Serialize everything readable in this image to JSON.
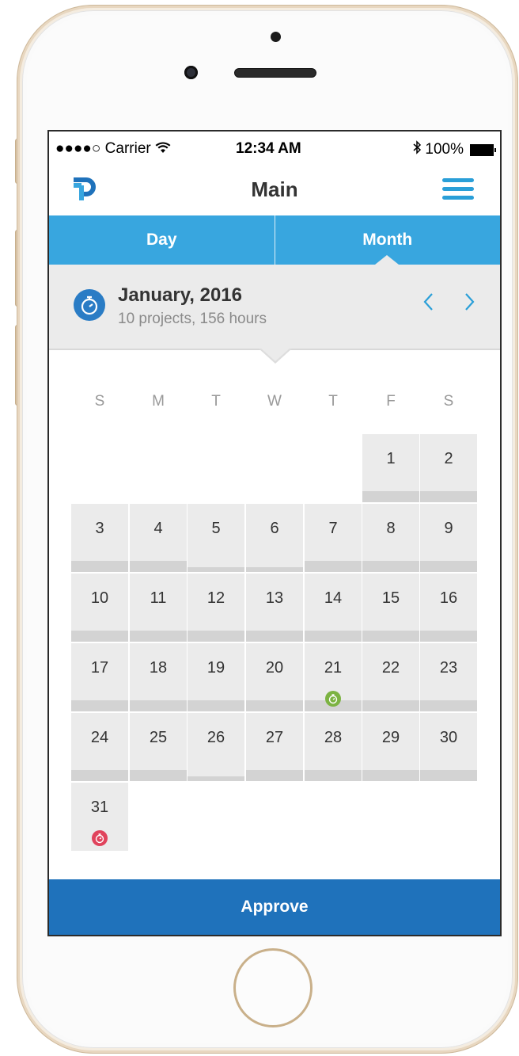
{
  "status_bar": {
    "signal": "●●●●○ Carrier",
    "time": "12:34 AM",
    "battery": "100%"
  },
  "navbar": {
    "title": "Main"
  },
  "tabs": [
    {
      "label": "Day"
    },
    {
      "label": "Month",
      "active": true
    }
  ],
  "month_header": {
    "title": "January, 2016",
    "subtitle": "10 projects, 156 hours"
  },
  "weekdays": [
    "S",
    "M",
    "T",
    "W",
    "T",
    "F",
    "S"
  ],
  "calendar": [
    {
      "day": "1"
    },
    {
      "day": "2"
    },
    {
      "day": "3"
    },
    {
      "day": "4"
    },
    {
      "day": "5"
    },
    {
      "day": "6"
    },
    {
      "day": "7"
    },
    {
      "day": "8"
    },
    {
      "day": "9"
    },
    {
      "day": "10"
    },
    {
      "day": "11"
    },
    {
      "day": "12"
    },
    {
      "day": "13"
    },
    {
      "day": "14"
    },
    {
      "day": "15"
    },
    {
      "day": "16"
    },
    {
      "day": "17"
    },
    {
      "day": "18"
    },
    {
      "day": "19"
    },
    {
      "day": "20"
    },
    {
      "day": "21"
    },
    {
      "day": "22"
    },
    {
      "day": "23"
    },
    {
      "day": "24"
    },
    {
      "day": "25"
    },
    {
      "day": "26"
    },
    {
      "day": "27"
    },
    {
      "day": "28"
    },
    {
      "day": "29"
    },
    {
      "day": "30"
    },
    {
      "day": "31"
    }
  ],
  "markers": {
    "21": "#7cb342",
    "31": "#e0435c"
  },
  "colors": {
    "accent": "#38a6df",
    "primary": "#1f72bb"
  },
  "approve_label": "Approve"
}
